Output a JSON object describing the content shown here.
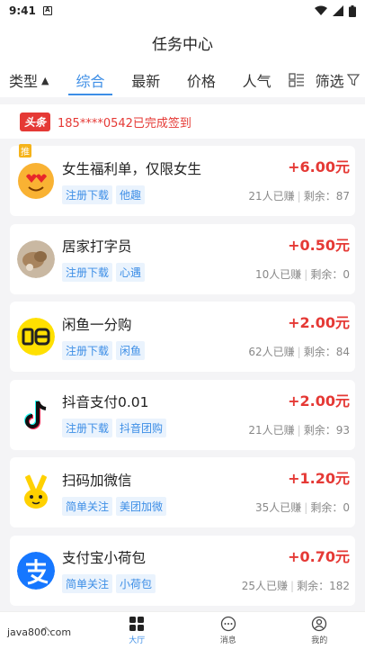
{
  "status": {
    "time": "9:41",
    "notif": "A"
  },
  "title": "任务中心",
  "filters": {
    "type": "类型",
    "tabs": [
      "综合",
      "最新",
      "价格",
      "人气"
    ],
    "screen": "筛选"
  },
  "headline": {
    "tag": "头条",
    "text": "185****0542已完成签到"
  },
  "hot_badge": "推",
  "stats_labels": {
    "earned_suffix": "人已赚",
    "remain_prefix": "剩余："
  },
  "tasks": [
    {
      "name": "女生福利单，仅限女生",
      "tags": [
        "注册下载",
        "他趣"
      ],
      "price": "+6.00元",
      "earned": "21",
      "remain": "87",
      "icon": "face-hearts-icon"
    },
    {
      "name": "居家打字员",
      "tags": [
        "注册下载",
        "心遇"
      ],
      "price": "+0.50元",
      "earned": "10",
      "remain": "0",
      "icon": "cat-photo-icon"
    },
    {
      "name": "闲鱼一分购",
      "tags": [
        "注册下载",
        "闲鱼"
      ],
      "price": "+2.00元",
      "earned": "62",
      "remain": "84",
      "icon": "xianyu-logo-icon"
    },
    {
      "name": "抖音支付0.01",
      "tags": [
        "注册下载",
        "抖音团购"
      ],
      "price": "+2.00元",
      "earned": "21",
      "remain": "93",
      "icon": "douyin-logo-icon"
    },
    {
      "name": "扫码加微信",
      "tags": [
        "简单关注",
        "美团加微"
      ],
      "price": "+1.20元",
      "earned": "35",
      "remain": "0",
      "icon": "meituan-mascot-icon"
    },
    {
      "name": "支付宝小荷包",
      "tags": [
        "简单关注",
        "小荷包"
      ],
      "price": "+0.70元",
      "earned": "25",
      "remain": "182",
      "icon": "alipay-logo-icon"
    }
  ],
  "tabbar": [
    "大厅",
    "消息",
    "我的"
  ],
  "watermark": "java800.com",
  "colors": {
    "accent": "#3d8ee6",
    "price": "#e53935"
  }
}
